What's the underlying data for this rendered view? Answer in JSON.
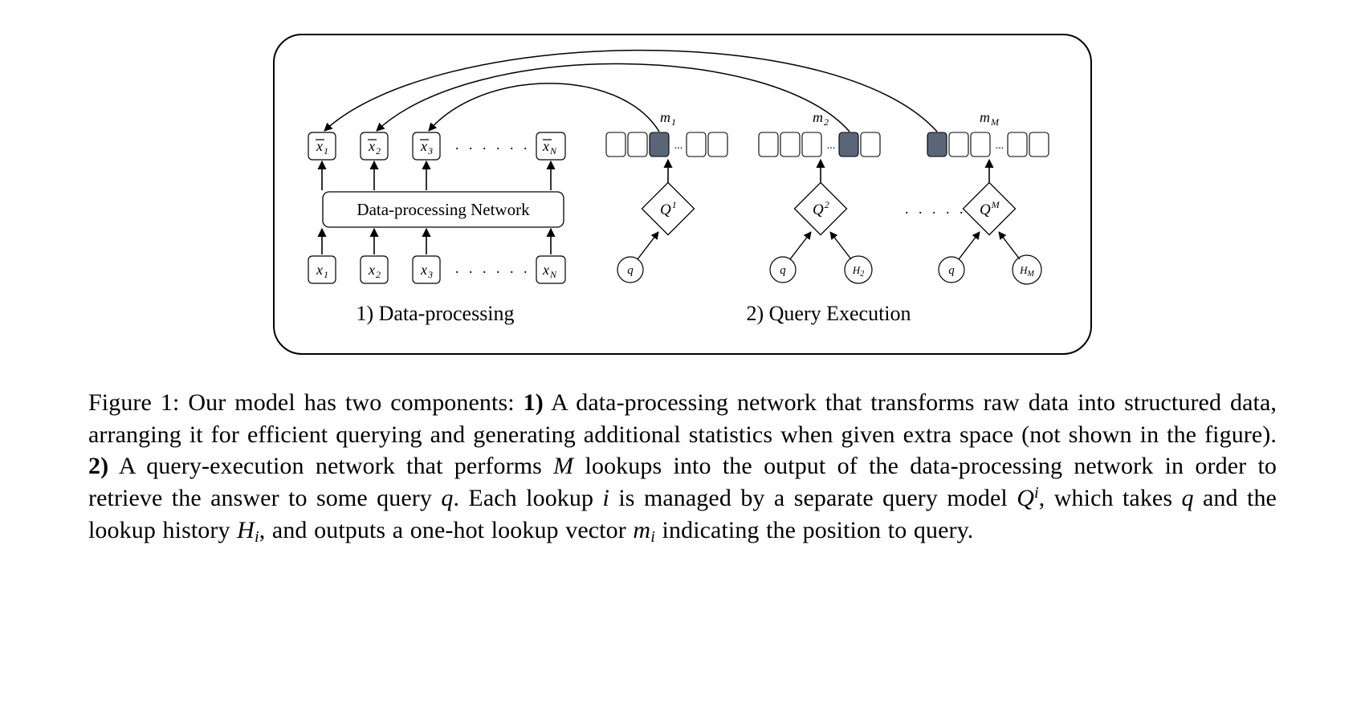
{
  "figure": {
    "data_processing_label": "1) Data-processing",
    "query_execution_label": "2) Query Execution",
    "dp_network_box": "Data-processing Network",
    "inputs": {
      "x1": "x",
      "x1_sub": "1",
      "x2": "x",
      "x2_sub": "2",
      "x3": "x",
      "x3_sub": "3",
      "xN": "x",
      "xN_sub": "N"
    },
    "outputs": {
      "xbar1": "x",
      "xbar1_sub": "1",
      "xbar2": "x",
      "xbar2_sub": "2",
      "xbar3": "x",
      "xbar3_sub": "3",
      "xbarN": "x",
      "xbarN_sub": "N"
    },
    "dots": ". . . . . . .",
    "q_dots": ". . . . . . . .",
    "m_labels": {
      "m1": "m",
      "m1_sub": "1",
      "m2": "m",
      "m2_sub": "2",
      "mM": "m",
      "mM_sub": "M"
    },
    "Q_labels": {
      "Q1": "Q",
      "Q1_sup": "1",
      "Q2": "Q",
      "Q2_sup": "2",
      "QM": "Q",
      "QM_sup": "M"
    },
    "q_node": "q",
    "H_nodes": {
      "H2": "H",
      "H2_sub": "2",
      "HM": "H",
      "HM_sub": "M"
    },
    "mrow_dots": "..."
  },
  "caption": {
    "fig_label": "Figure 1:",
    "t1": " Our model has two components: ",
    "b1": "1)",
    "t2": " A data-processing network that transforms raw data into structured data, arranging it for efficient querying and generating additional statistics when given extra space (not shown in the figure). ",
    "b2": "2)",
    "t3": " A query-execution network that performs ",
    "M": "M",
    "t4": " lookups into the output of the data-processing network in order to retrieve the answer to some query ",
    "q": "q",
    "t5": ". Each lookup ",
    "i": "i",
    "t6": " is managed by a separate query model ",
    "Q": "Q",
    "Q_sup_i": "i",
    "t7": ", which takes ",
    "q2": "q",
    "t8": " and the lookup history ",
    "H": "H",
    "H_sub_i": "i",
    "t9": ", and outputs a one-hot lookup vector ",
    "m": "m",
    "m_sub_i": "i",
    "t10": " indicating the position to query."
  },
  "colors": {
    "fill_dark": "#5a6677",
    "stroke": "#000000"
  }
}
